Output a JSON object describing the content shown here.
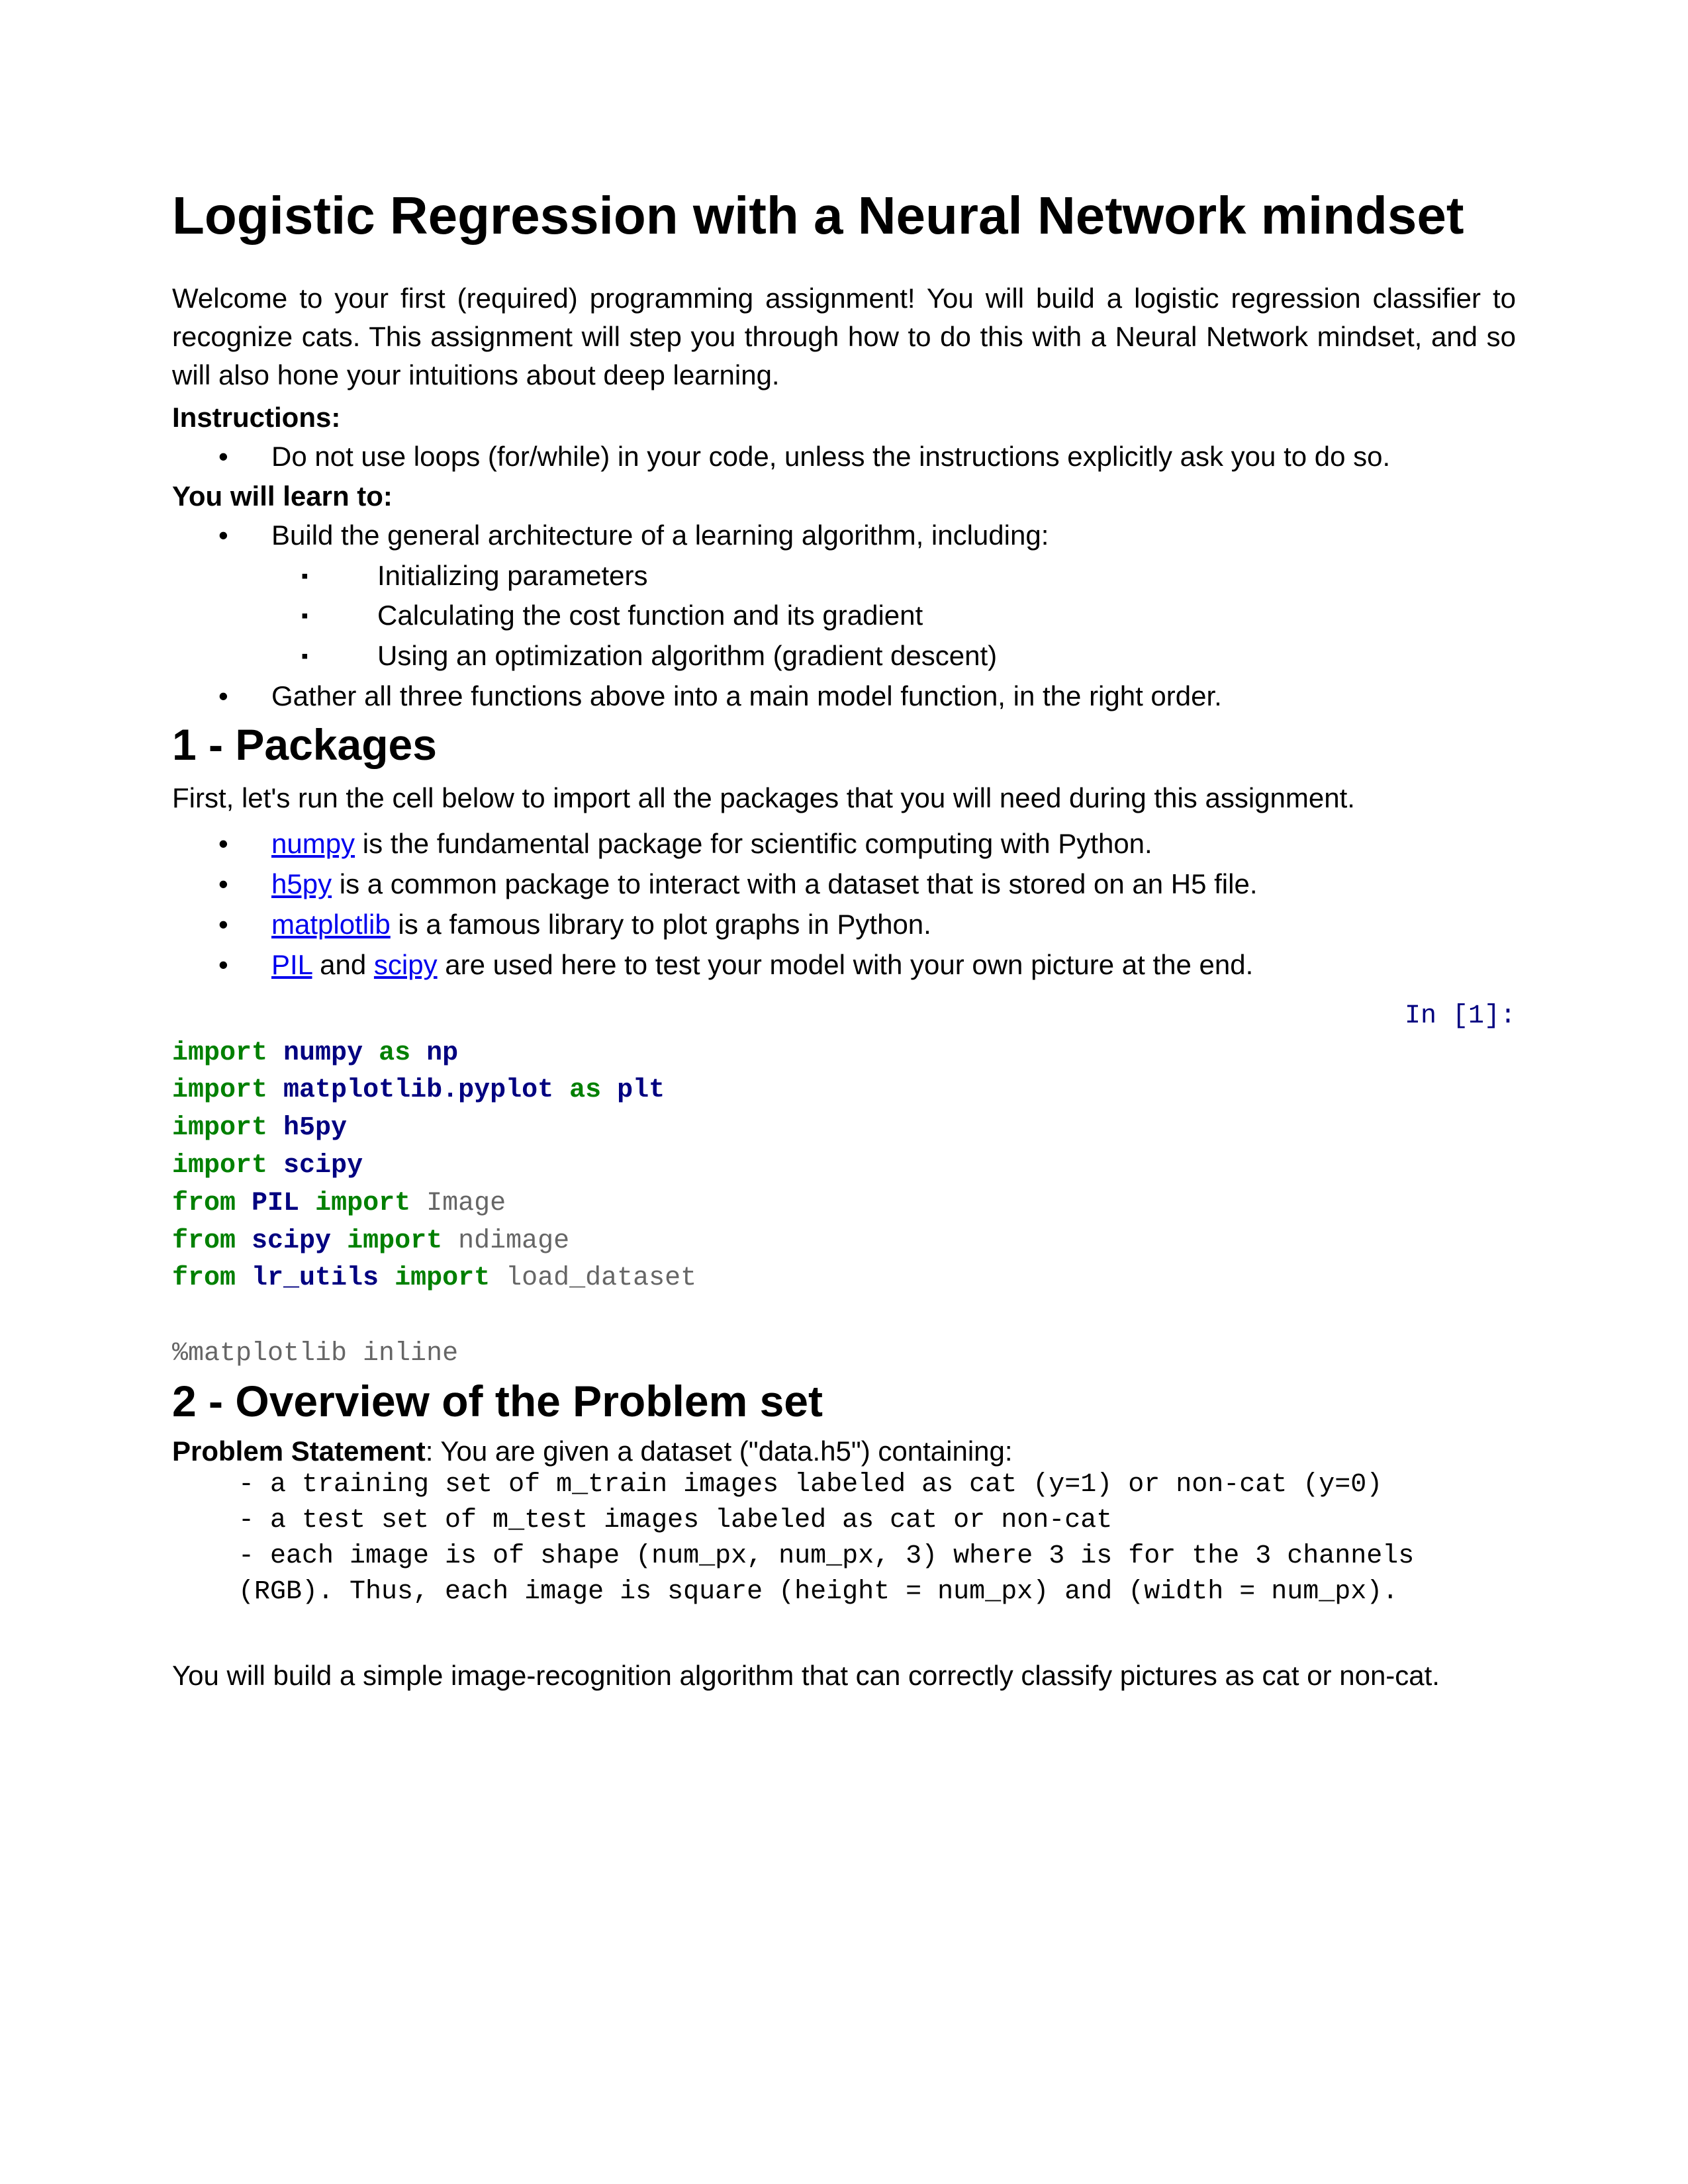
{
  "h1": "Logistic Regression with a Neural Network mindset",
  "intro": "Welcome to your first (required) programming assignment! You will build a logistic regression classifier to recognize cats. This assignment will step you through how to do this with a Neural Network mindset, and so will also hone your intuitions about deep learning.",
  "instructions_label": "Instructions:",
  "inst_item": "Do not use loops (for/while) in your code, unless the instructions explicitly ask you to do so.",
  "learn_label": "You will learn to:",
  "learn_1": "Build the general architecture of a learning algorithm, including:",
  "learn_1a": "Initializing parameters",
  "learn_1b": "Calculating the cost function and its gradient",
  "learn_1c": "Using an optimization algorithm (gradient descent)",
  "learn_2": "Gather all three functions above into a main model function, in the right order.",
  "h2_1": "1 - Packages",
  "packages_intro": "First, let's run the cell below to import all the packages that you will need during this assignment.",
  "pkg_numpy": "numpy",
  "pkg_numpy_desc": " is the fundamental package for scientific computing with Python.",
  "pkg_h5py": "h5py",
  "pkg_h5py_desc": " is a common package to interact with a dataset that is stored on an H5 file.",
  "pkg_matplotlib": "matplotlib",
  "pkg_matplotlib_desc": " is a famous library to plot graphs in Python.",
  "pkg_pil": "PIL",
  "pkg_and": " and ",
  "pkg_scipy": "scipy",
  "pkg_pil_desc": " are used here to test your model with your own picture at the end.",
  "in_label": "In [1]:",
  "code": {
    "import": "import",
    "from": "from",
    "as": "as",
    "numpy": "numpy",
    "np": "np",
    "mpl": "matplotlib.pyplot",
    "plt": "plt",
    "h5py": "h5py",
    "scipy": "scipy",
    "pil": "PIL",
    "image": "Image",
    "ndimage": "ndimage",
    "lrutils": "lr_utils",
    "load": "load_dataset",
    "magic": "%matplotlib inline"
  },
  "h2_2": "2 - Overview of the Problem set",
  "problem_label": "Problem Statement",
  "problem_desc": ": You are given a dataset (\"data.h5\") containing:",
  "block_1": "- a training set of m_train images labeled as cat (y=1) or non-cat (y=0)",
  "block_2": "- a test set of m_test images labeled as cat or non-cat",
  "block_3": "- each image is of shape (num_px, num_px, 3) where 3 is for the 3 channels (RGB). Thus, each image is square (height = num_px) and (width = num_px).",
  "closing": "You will build a simple image-recognition algorithm that can correctly classify pictures as cat or non-cat."
}
